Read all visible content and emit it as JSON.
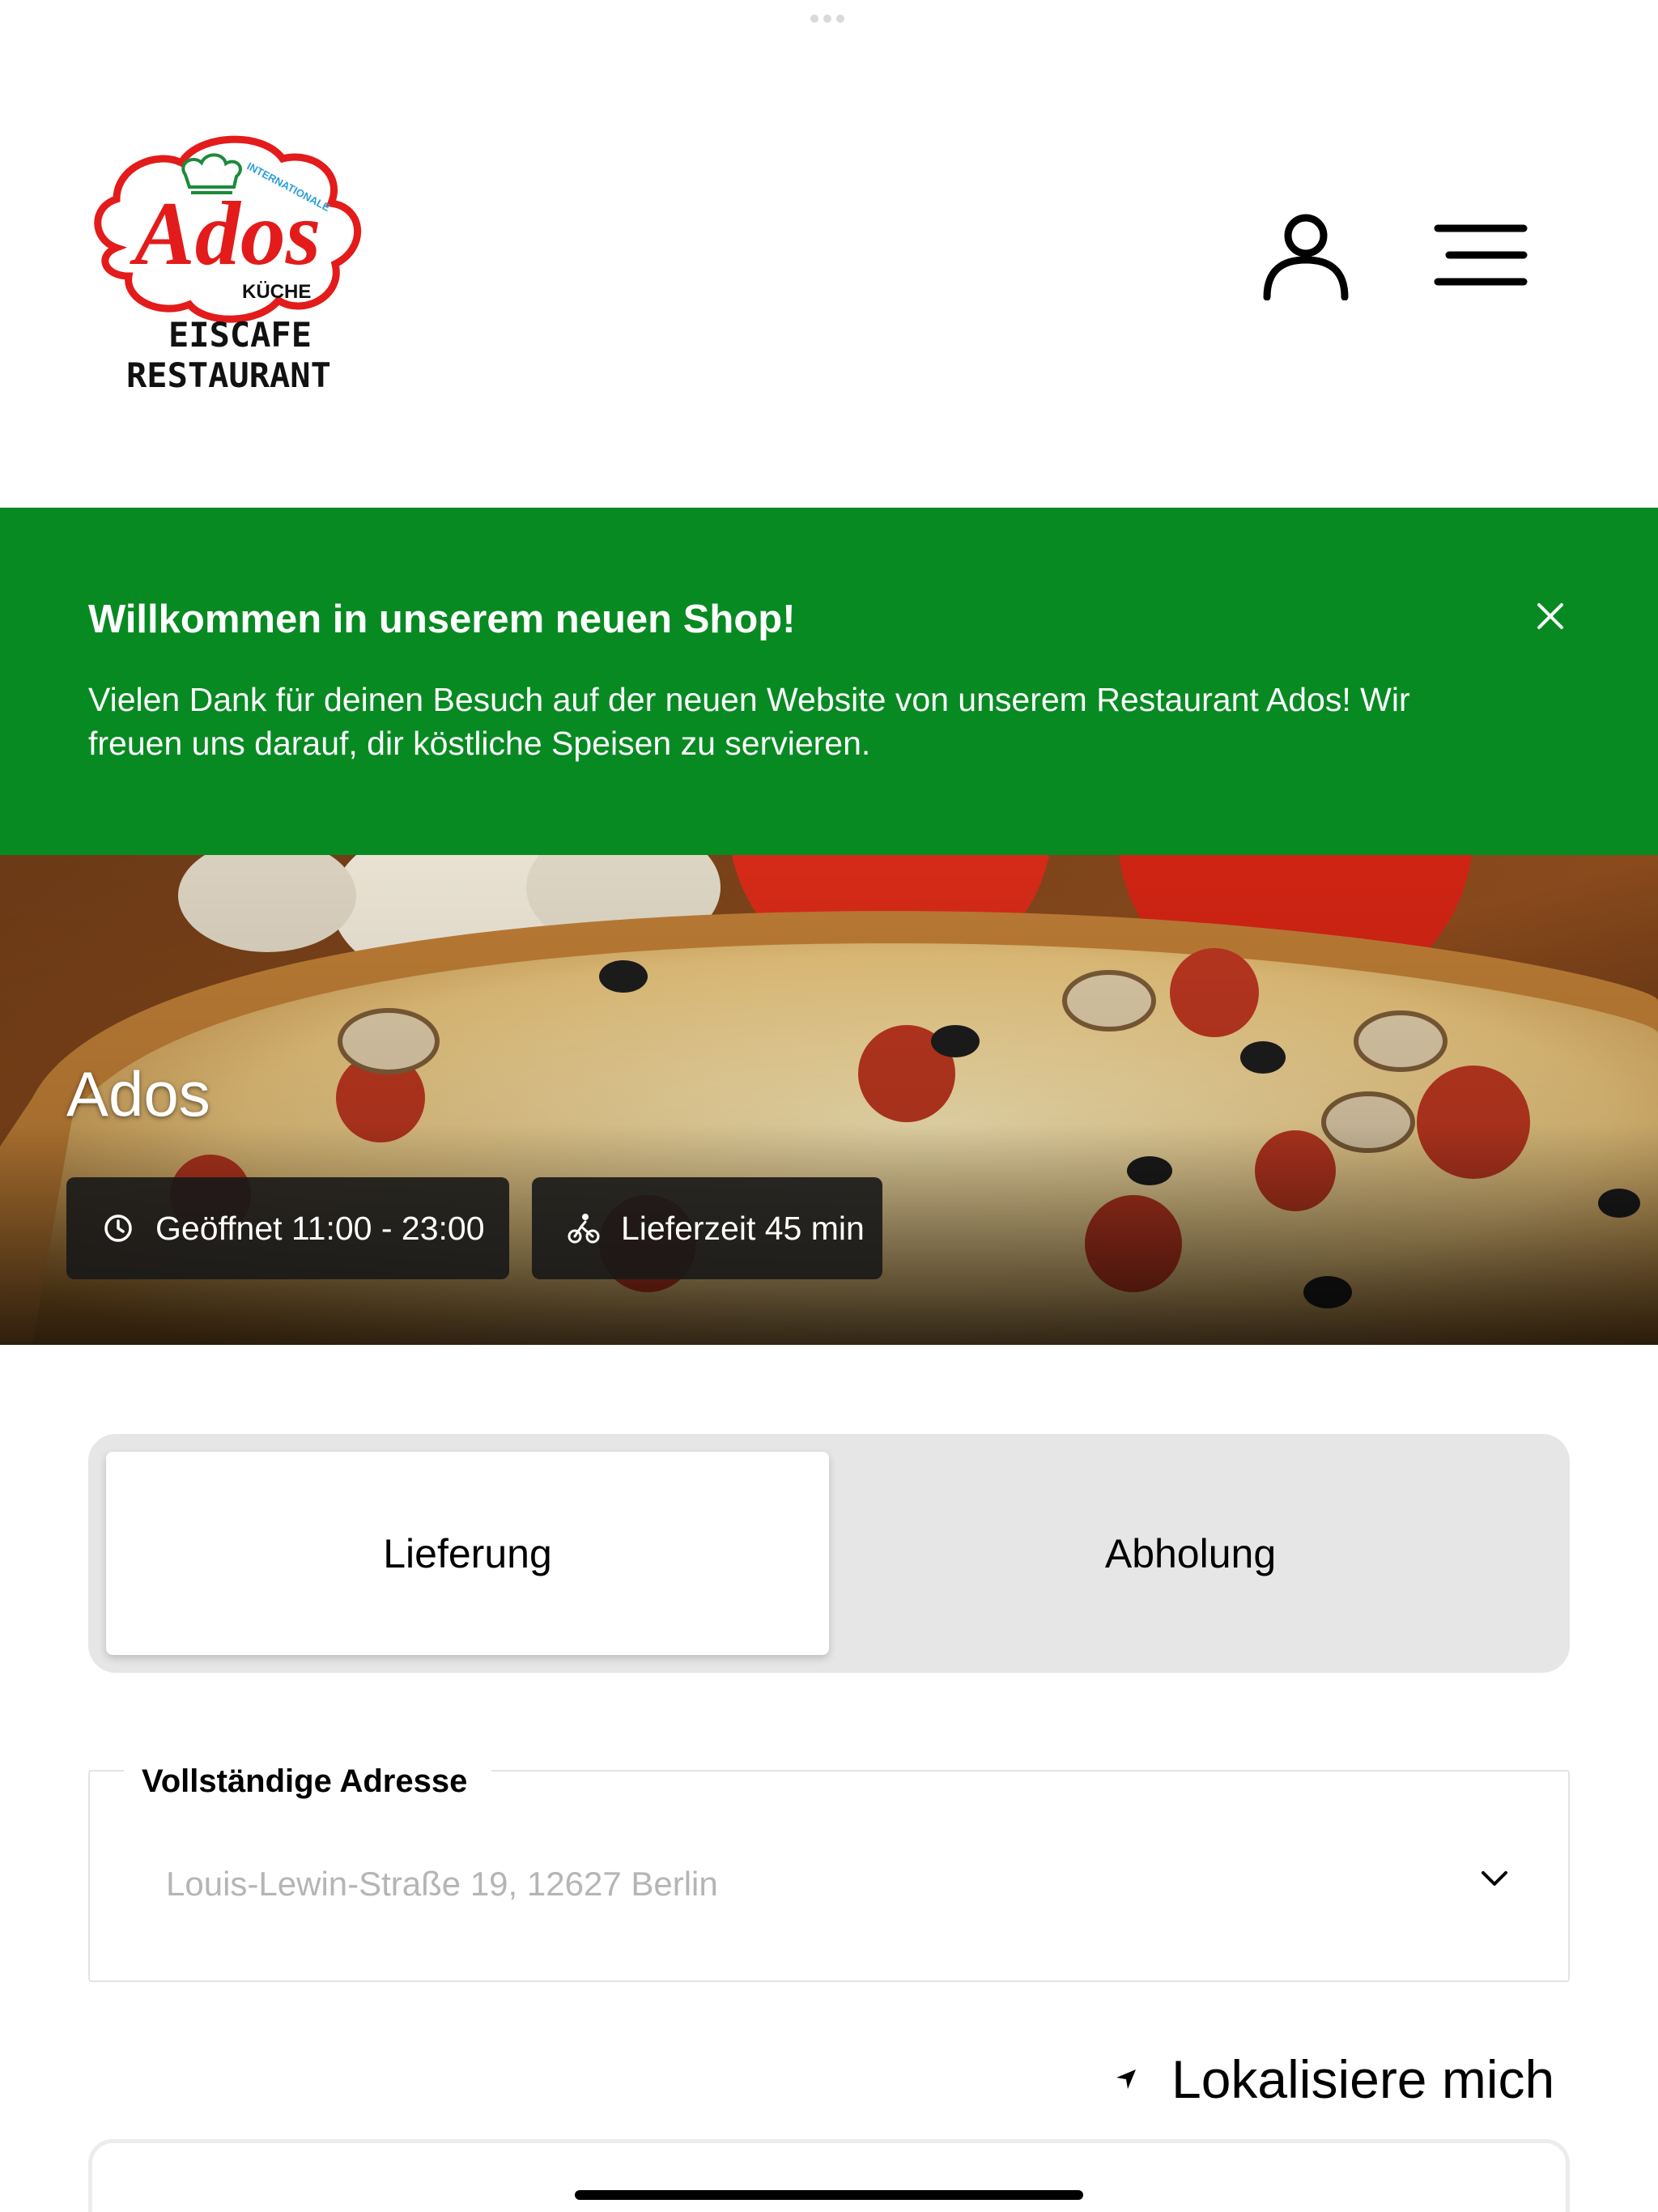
{
  "header": {
    "logo": {
      "arc_text": "INTERNATIONALE",
      "brand": "Ados",
      "sub": "KÜCHE",
      "line1": "EISCAFE",
      "line2": "RESTAURANT"
    },
    "account_icon": "user-icon",
    "menu_icon": "hamburger-menu-icon"
  },
  "banner": {
    "title": "Willkommen in unserem neuen Shop!",
    "text": "Vielen Dank für deinen Besuch auf der neuen Website von unserem Restaurant Ados! Wir freuen uns darauf, dir köstliche Speisen zu servieren.",
    "close_icon": "close-icon",
    "color": "#078a22"
  },
  "hero": {
    "restaurant_name": "Ados",
    "opening_hours": "Geöffnet 11:00 - 23:00",
    "delivery_time": "Lieferzeit 45 min"
  },
  "order_mode": {
    "options": [
      "Lieferung",
      "Abholung"
    ],
    "selected": "Lieferung"
  },
  "address": {
    "label": "Vollständige Adresse",
    "placeholder": "Louis-Lewin-Straße 19, 12627 Berlin"
  },
  "locate": {
    "label": "Lokalisiere mich",
    "icon": "location-arrow-icon"
  }
}
